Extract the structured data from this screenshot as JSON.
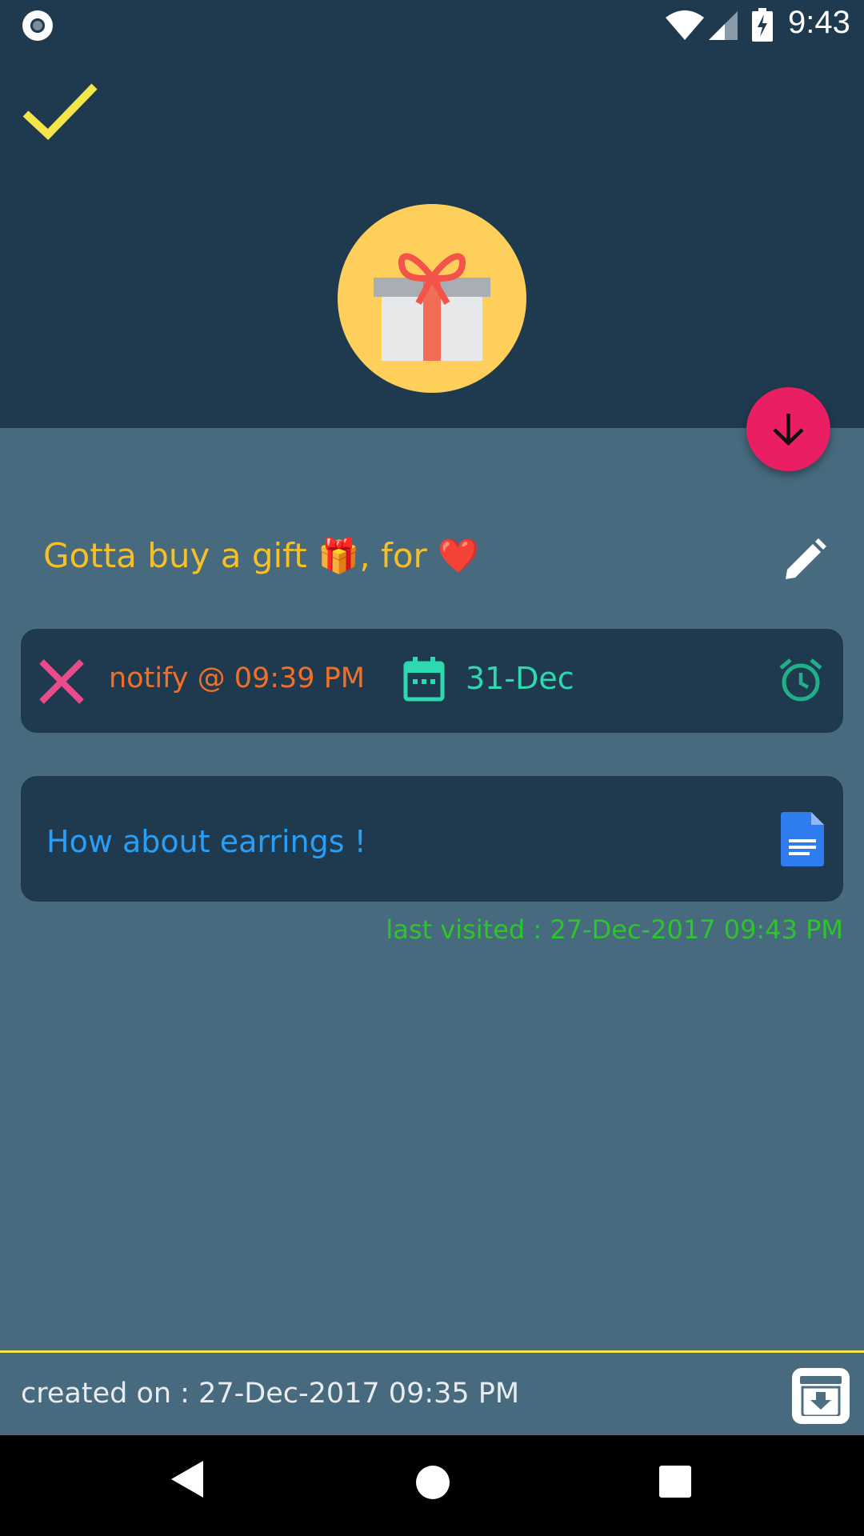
{
  "status_bar": {
    "time": "9:43"
  },
  "note": {
    "title": "Gotta buy a gift 🎁, for ❤️",
    "body": "How about earrings !"
  },
  "reminder": {
    "notify_text": "notify @ 09:39 PM",
    "date": "31-Dec"
  },
  "meta": {
    "last_visited": "last visited : 27-Dec-2017 09:43 PM",
    "created_on": "created on : 27-Dec-2017 09:35 PM"
  },
  "colors": {
    "header_bg": "#1f3a4e",
    "body_bg": "#476a7e",
    "accent_yellow": "#f4e54a",
    "fab_pink": "#e91e63",
    "title_orange": "#f5bf2a",
    "notify_orange": "#f0702a",
    "date_teal": "#2ed9b0",
    "note_blue": "#2a9df4",
    "visited_green": "#2ec42b"
  },
  "icons": {
    "check": "check-icon",
    "gift": "gift-icon",
    "fab": "arrow-down-icon",
    "edit": "pencil-icon",
    "cancel": "close-icon",
    "calendar": "calendar-icon",
    "alarm": "alarm-clock-icon",
    "document": "document-icon",
    "archive": "archive-icon"
  }
}
